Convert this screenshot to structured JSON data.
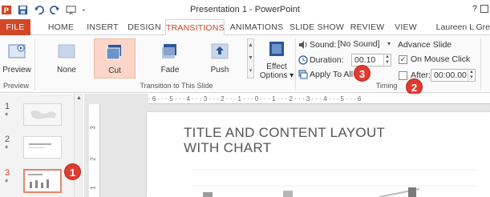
{
  "window": {
    "title": "Presentation 1 - PowerPoint",
    "help": "?",
    "user": "Laureen L Gre"
  },
  "qat_icons": [
    "powerpoint-logo-icon",
    "save-icon",
    "undo-icon",
    "redo-icon",
    "start-slideshow-icon",
    "customize-dropdown-icon"
  ],
  "tabs": [
    {
      "label": "FILE"
    },
    {
      "label": "HOME"
    },
    {
      "label": "INSERT"
    },
    {
      "label": "DESIGN"
    },
    {
      "label": "TRANSITIONS",
      "active": true
    },
    {
      "label": "ANIMATIONS"
    },
    {
      "label": "SLIDE SHOW"
    },
    {
      "label": "REVIEW"
    },
    {
      "label": "VIEW"
    }
  ],
  "ribbon": {
    "preview": {
      "button": "Preview",
      "group": "Preview"
    },
    "transitions": {
      "group": "Transition to This Slide",
      "gallery": [
        {
          "label": "None"
        },
        {
          "label": "Cut",
          "selected": true
        },
        {
          "label": "Fade"
        },
        {
          "label": "Push"
        }
      ],
      "effect_options": "Effect Options",
      "effect_options_line1": "Effect",
      "effect_options_line2": "Options"
    },
    "timing": {
      "group": "Timing",
      "sound_label": "Sound:",
      "sound_value": "[No Sound]",
      "duration_label": "Duration:",
      "duration_value": "00.10",
      "apply_to_all": "Apply To All",
      "advance_slide": "Advance Slide",
      "on_mouse_click": "On Mouse Click",
      "on_mouse_click_checked": true,
      "after_label": "After:",
      "after_value": "00:00.00",
      "after_checked": false
    }
  },
  "callouts": [
    "1",
    "2",
    "3"
  ],
  "thumbnails": [
    {
      "number": "1",
      "star": "*"
    },
    {
      "number": "2",
      "star": "*"
    },
    {
      "number": "3",
      "star": "*",
      "selected": true
    }
  ],
  "ruler": {
    "horizontal": "· 6 · · · 5 · · · 4 · · · 3 · · · 2 · · · 1 · · · 0 · · · 1 · · · 2 · · · 3 · · · 4 · · · 5 · · · 6",
    "vertical": [
      "3",
      "2",
      "1"
    ]
  },
  "slide": {
    "title_line1": "TITLE AND CONTENT LAYOUT",
    "title_line2": "WITH CHART"
  },
  "colors": {
    "accent": "#d24726",
    "selected_transition": "#fcd5c9",
    "callout": "#e23a2e"
  }
}
